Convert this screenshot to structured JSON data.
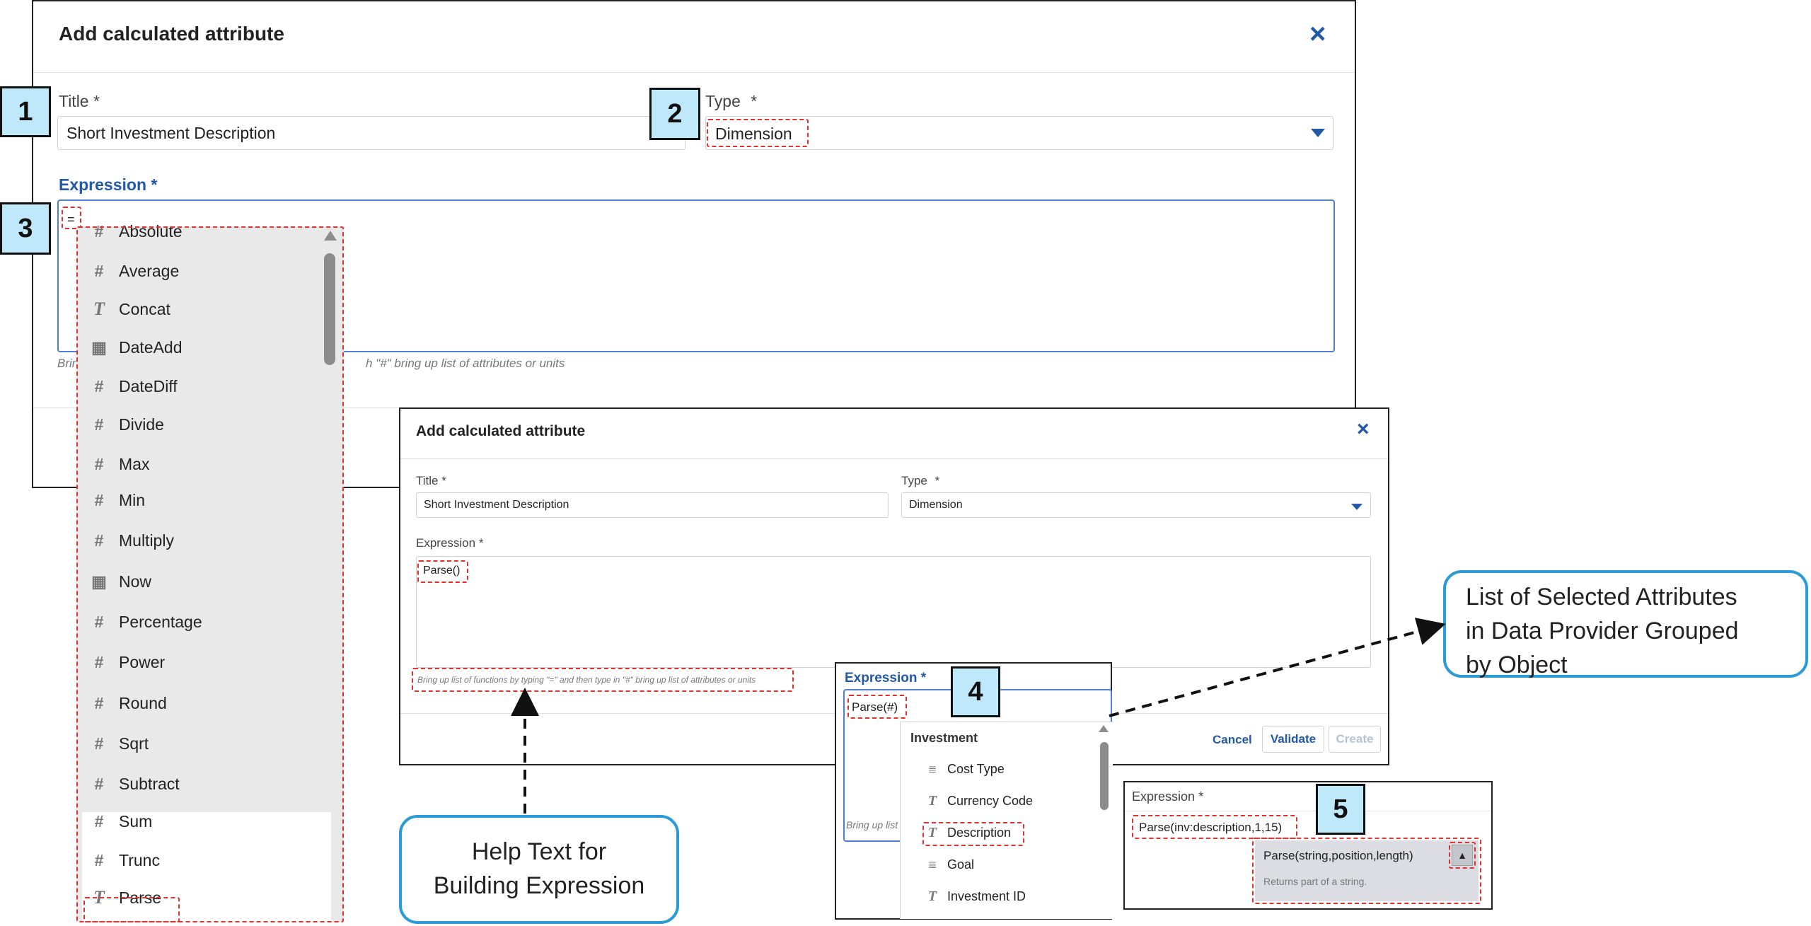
{
  "dialog1": {
    "title": "Add calculated attribute",
    "close_icon": "×",
    "title_label": "Title",
    "required_mark": "*",
    "title_value": "Short Investment Description",
    "type_label": "Type",
    "type_value": "Dimension",
    "expression_label": "Expression",
    "expression_value": "=",
    "hint_left": "Brin",
    "hint_right": "h \"#\" bring up list of attributes or units"
  },
  "function_list": {
    "items": [
      {
        "icon": "hash-icon",
        "glyph": "#",
        "label": "Absolute"
      },
      {
        "icon": "hash-icon",
        "glyph": "#",
        "label": "Average"
      },
      {
        "icon": "text-icon",
        "glyph": "T",
        "label": "Concat"
      },
      {
        "icon": "calendar-icon",
        "glyph": "▦",
        "label": "DateAdd"
      },
      {
        "icon": "hash-icon",
        "glyph": "#",
        "label": "DateDiff"
      },
      {
        "icon": "hash-icon",
        "glyph": "#",
        "label": "Divide"
      },
      {
        "icon": "hash-icon",
        "glyph": "#",
        "label": "Max"
      },
      {
        "icon": "hash-icon",
        "glyph": "#",
        "label": "Min"
      },
      {
        "icon": "hash-icon",
        "glyph": "#",
        "label": "Multiply"
      },
      {
        "icon": "calendar-icon",
        "glyph": "▦",
        "label": "Now"
      },
      {
        "icon": "hash-icon",
        "glyph": "#",
        "label": "Percentage"
      },
      {
        "icon": "hash-icon",
        "glyph": "#",
        "label": "Power"
      },
      {
        "icon": "hash-icon",
        "glyph": "#",
        "label": "Round"
      },
      {
        "icon": "hash-icon",
        "glyph": "#",
        "label": "Sqrt"
      },
      {
        "icon": "hash-icon",
        "glyph": "#",
        "label": "Subtract"
      },
      {
        "icon": "hash-icon",
        "glyph": "#",
        "label": "Sum"
      },
      {
        "icon": "hash-icon",
        "glyph": "#",
        "label": "Trunc"
      },
      {
        "icon": "text-icon",
        "glyph": "T",
        "label": "Parse"
      }
    ]
  },
  "dialog2": {
    "title": "Add calculated attribute",
    "close_icon": "×",
    "title_label": "Title",
    "required_mark": "*",
    "title_value": "Short Investment Description",
    "type_label": "Type",
    "type_value": "Dimension",
    "expression_label": "Expression",
    "expression_value": "Parse()",
    "hint": "Bring up list of functions by typing \"=\" and then type in \"#\" bring up list of attributes or units",
    "cancel_label": "Cancel",
    "validate_label": "Validate",
    "create_label": "Create"
  },
  "panel4": {
    "expression_label": "Expression",
    "required_mark": "*",
    "expression_value": "Parse(#)",
    "hint_fragment": "Bring up list",
    "group": "Investment",
    "items": [
      {
        "icon": "measure-icon",
        "glyph": "≣",
        "label": "Cost Type"
      },
      {
        "icon": "text-icon",
        "glyph": "T",
        "label": "Currency Code"
      },
      {
        "icon": "text-icon",
        "glyph": "T",
        "label": "Description"
      },
      {
        "icon": "measure-icon",
        "glyph": "≣",
        "label": "Goal"
      },
      {
        "icon": "text-icon",
        "glyph": "T",
        "label": "Investment ID"
      }
    ]
  },
  "panel5": {
    "expression_label": "Expression",
    "required_mark": "*",
    "expression_value": "Parse(inv:description,1,15)",
    "tooltip_signature": "Parse(string,position,length)",
    "tooltip_description": "Returns part of a string.",
    "collapse_icon": "▲"
  },
  "markers": [
    "1",
    "2",
    "3",
    "4",
    "5"
  ],
  "callouts": {
    "selected_attributes": [
      "List of Selected Attributes",
      "in Data Provider Grouped",
      "by Object"
    ],
    "help_text": [
      "Help Text for",
      "Building Expression"
    ]
  },
  "colors": {
    "accent": "#2158a8",
    "highlight_dash": "#e0302f",
    "callout_border": "#2a9bd6",
    "marker_fill": "#bfe8fb"
  }
}
